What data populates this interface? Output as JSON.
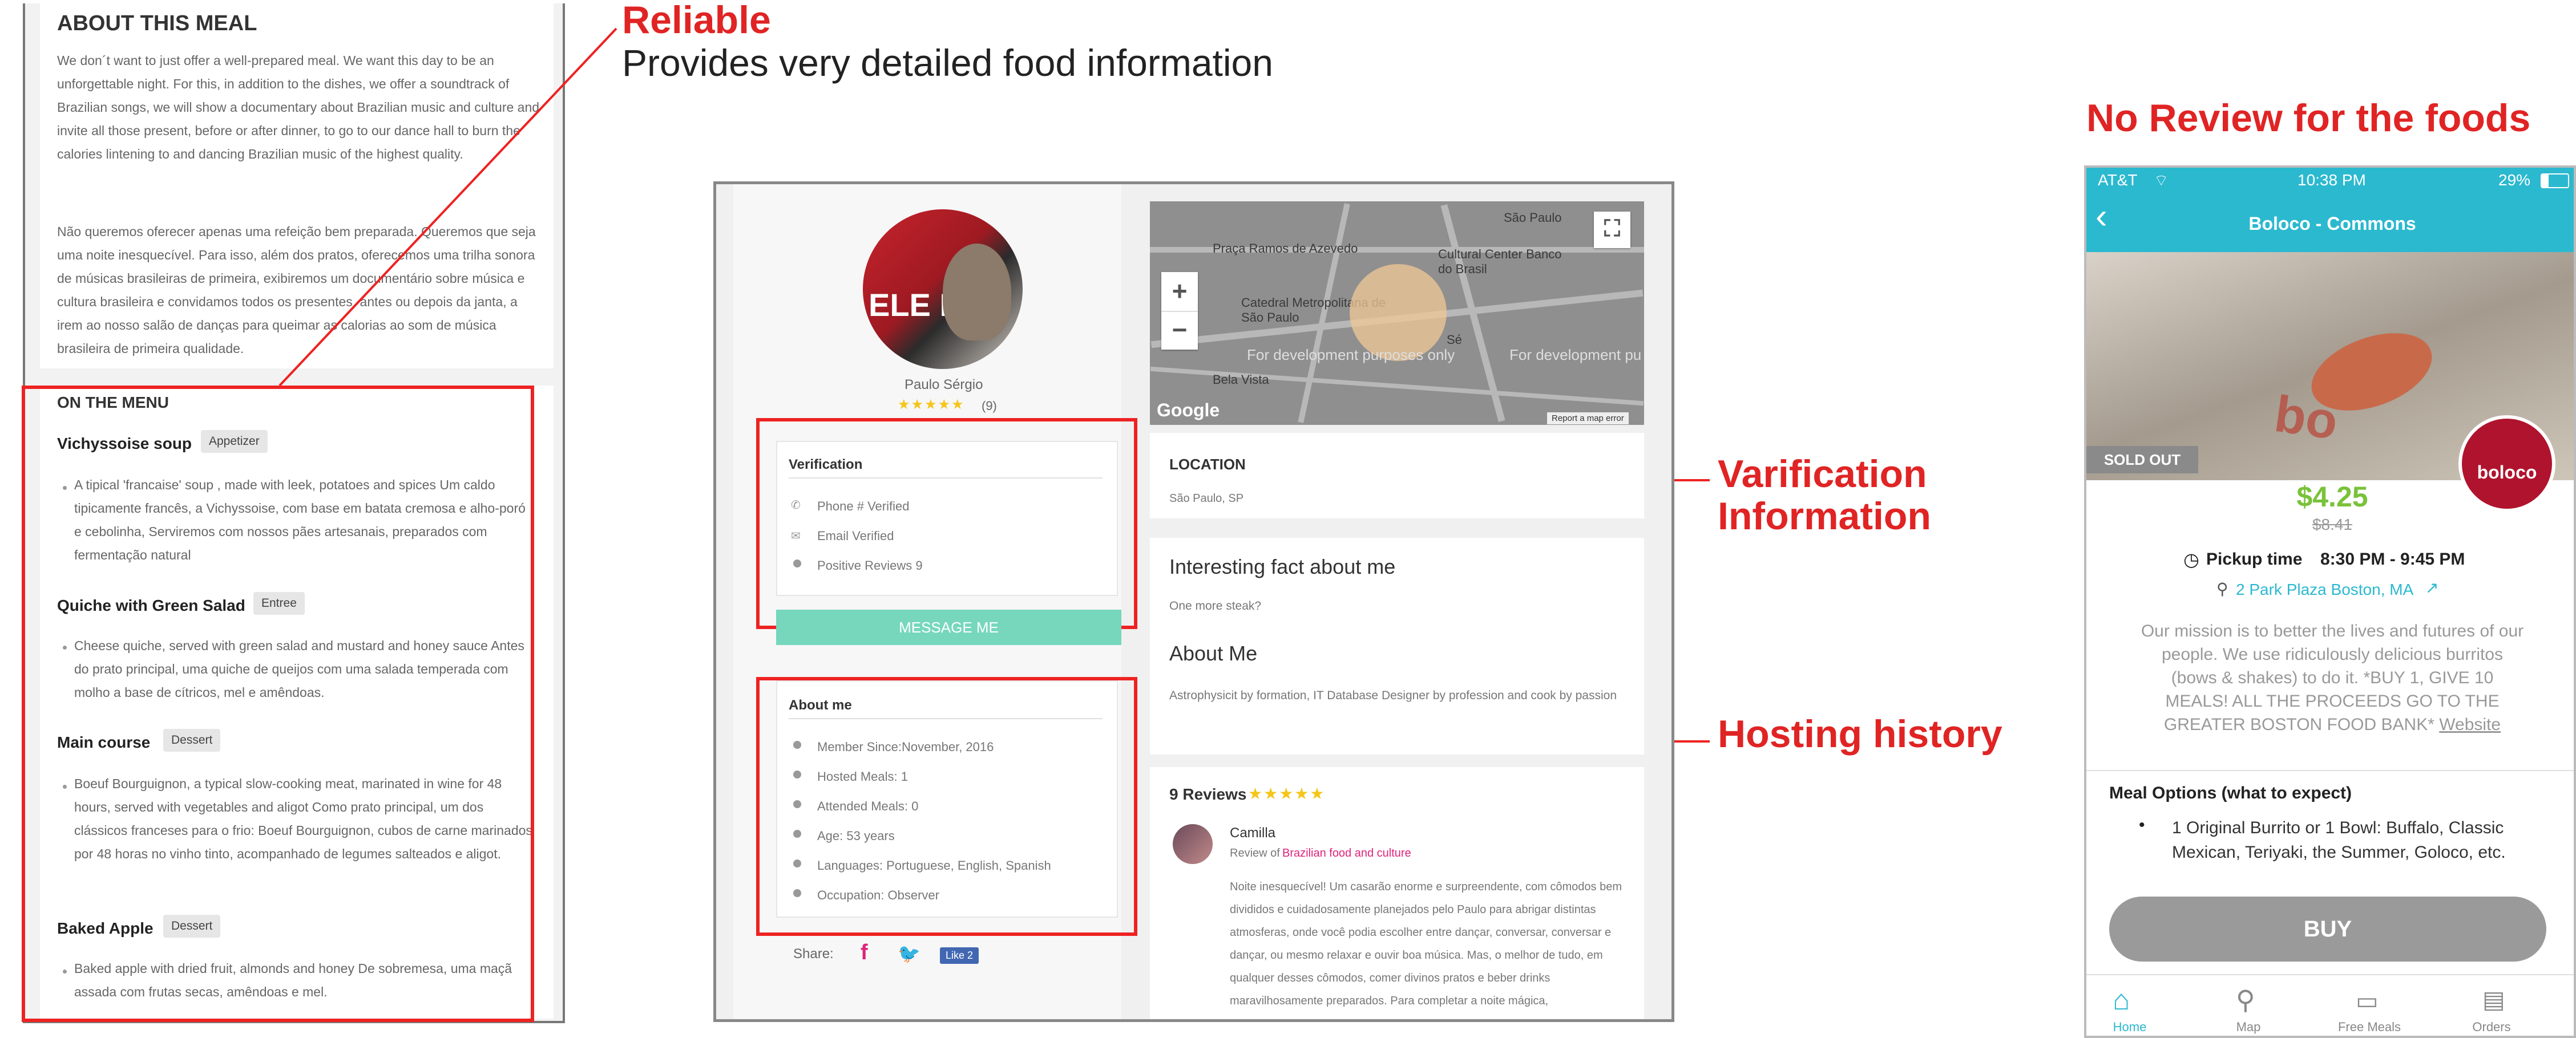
{
  "panel_about": {
    "heading": "ABOUT THIS MEAL",
    "paragraph_en": "We don´t want to just offer a well-prepared meal. We want this day to be an unforgettable night. For this, in addition to the dishes, we offer a soundtrack of Brazilian songs, we will show a documentary about Brazilian music and culture and invite all those present, before or after dinner, to go to our dance hall to burn the calories lintening to and dancing Brazilian music of the highest quality.",
    "paragraph_pt": "Não queremos oferecer apenas uma refeição bem preparada. Queremos que seja uma noite inesquecível. Para isso, além dos pratos, oferecemos uma trilha sonora de músicas brasileiras de primeira, exibiremos um documentário sobre música e cultura brasileira e convidamos todos os presentes, antes ou depois da janta, a irem ao nosso salão de danças para queimar as calorias ao som de música brasileira de primeira qualidade.",
    "menu_heading": "ON THE MENU",
    "dishes": [
      {
        "name": "Vichyssoise soup",
        "tag": "Appetizer",
        "desc": "A tipical 'francaise' soup , made with leek, potatoes and spices Um caldo tipicamente francês, a Vichyssoise, com base em batata cremosa e alho-poró e cebolinha, Serviremos com nossos pães artesanais, preparados com fermentação natural"
      },
      {
        "name": "Quiche with Green Salad",
        "tag": "Entree",
        "desc": "Cheese quiche, served with green salad and mustard and honey sauce Antes do prato principal, uma quiche de queijos com uma salada temperada com molho a base de cítricos, mel e amêndoas."
      },
      {
        "name": "Main course",
        "tag": "Dessert",
        "desc": "Boeuf Bourguignon, a typical slow-cooking meat, marinated in wine for 48 hours, served with vegetables and aligot Como prato principal, um dos clássicos franceses para o frio: Boeuf Bourguignon, cubos de carne marinados por 48 horas no vinho tinto, acompanhado de legumes salteados e aligot."
      },
      {
        "name": "Baked Apple",
        "tag": "Dessert",
        "desc": "Baked apple with dried fruit, almonds and honey De sobremesa, uma maçã assada com frutas secas, amêndoas e mel."
      }
    ]
  },
  "annotations": {
    "reliable_title": "Reliable",
    "reliable_sub": "Provides very detailed food information",
    "no_review": "No Review for the foods",
    "verification_line1": "Varification",
    "verification_line2": "Information",
    "hosting": "Hosting history",
    "accent_color": "#e02424"
  },
  "panel_host": {
    "host_name": "Paulo Sérgio",
    "rating_stars": 5,
    "review_count": "(9)",
    "avatar_text": "ELE NÃO",
    "verification": {
      "title": "Verification",
      "items": [
        {
          "icon": "phone-icon",
          "label": "Phone # Verified"
        },
        {
          "icon": "email-icon",
          "label": "Email Verified"
        },
        {
          "icon": "dot-icon",
          "label": "Positive Reviews 9"
        }
      ]
    },
    "message_button": "MESSAGE ME",
    "about": {
      "title": "About me",
      "items": [
        "Member Since:November, 2016",
        "Hosted Meals: 1",
        "Attended Meals: 0",
        "Age: 53 years",
        "Languages: Portuguese, English, Spanish",
        "Occupation: Observer"
      ]
    },
    "share_label": "Share:",
    "fb_like": "Like 2",
    "map": {
      "labels": [
        "São Paulo",
        "Praça Ramos de Azevedo",
        "Cultural Center Banco do Brasil",
        "Catedral Metropolitana de São Paulo",
        "Sé",
        "Bela Vista"
      ],
      "dev_text_1": "For development purposes only",
      "dev_text_2": "For development pu",
      "google": "Google",
      "report": "Report a map error",
      "zoom_in": "+",
      "zoom_out": "−"
    },
    "location": {
      "title": "LOCATION",
      "value": "São Paulo, SP"
    },
    "fact": {
      "title": "Interesting fact about me",
      "value": "One more steak?"
    },
    "about_me": {
      "title": "About Me",
      "value": "Astrophysicit by formation, IT Database Designer by profession and cook by passion"
    },
    "reviews": {
      "title": "9 Reviews",
      "reviewer": "Camilla",
      "review_of_label": "Review of",
      "review_of_link": "Brazilian food and culture",
      "text": "Noite inesquecível! Um casarão enorme e surpreendente, com cômodos bem divididos e cuidadosamente planejados pelo Paulo para abrigar distintas atmosferas, onde você podia escolher entre dançar, conversar, conversar e dançar, ou mesmo relaxar e ouvir boa música. Mas, o melhor de tudo, em qualquer desses cômodos, comer divinos pratos e beber drinks maravilhosamente preparados. Para completar a noite mágica,"
    },
    "accent_green": "#76d7bd",
    "accent_pink": "#e0227a",
    "star_color": "#f5c518"
  },
  "panel_phone": {
    "status": {
      "carrier": "AT&T",
      "time": "10:38 PM",
      "battery": "29%"
    },
    "title": "Boloco - Commons",
    "sold_out": "SOLD OUT",
    "price": "$4.25",
    "old_price": "$8.41",
    "pickup_label": "Pickup time",
    "pickup_value": "8:30 PM - 9:45 PM",
    "address": "2 Park Plaza Boston, MA",
    "mission": "Our mission is to better the lives and futures of our people. We use ridiculously delicious burritos (bows & shakes) to do it. *BUY 1, GIVE 10 MEALS! ALL THE PROCEEDS GO TO THE GREATER BOSTON FOOD BANK*",
    "website": "Website",
    "options_title": "Meal Options (what to expect)",
    "options_text": "1 Original Burrito or 1 Bowl: Buffalo, Classic Mexican, Teriyaki, the Summer, Goloco, etc.",
    "buy": "BUY",
    "logo": "boloco",
    "nav": [
      "Home",
      "Map",
      "Free Meals",
      "Orders"
    ],
    "teal": "#2bb9cf",
    "price_green": "#79c23a"
  }
}
